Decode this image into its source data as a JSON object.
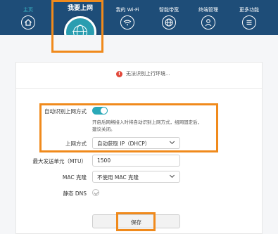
{
  "nav": {
    "items": [
      {
        "label": "主页"
      },
      {
        "label": "我要上网"
      },
      {
        "label": "我的 Wi-Fi"
      },
      {
        "label": "智能带宽"
      },
      {
        "label": "终端管理"
      },
      {
        "label": "更多功能"
      }
    ]
  },
  "alert": {
    "text": "无法识别上行环境..."
  },
  "form": {
    "auto_detect_label": "自动识别上网方式",
    "auto_detect_desc": "开启后网络接入时将自动识别上网方式，组网固定后，建议关闭。",
    "wan_mode_label": "上网方式",
    "wan_mode_value": "自动获取 IP（DHCP）",
    "mtu_label": "最大发送单元（MTU）",
    "mtu_value": "1500",
    "mac_clone_label": "MAC 克隆",
    "mac_clone_value": "不使用 MAC 克隆",
    "static_dns_label": "静态 DNS",
    "save_label": "保存"
  },
  "colors": {
    "nav_bg": "#1e4d78",
    "accent": "#2aa9b8",
    "highlight": "#f08a1c",
    "alert": "#e2483b"
  },
  "icons": [
    "home-icon",
    "globe-icon",
    "wifi-icon",
    "bandwidth-globe-icon",
    "user-icon",
    "menu-icon",
    "alert-icon",
    "chevron-down-icon",
    "check-icon"
  ]
}
